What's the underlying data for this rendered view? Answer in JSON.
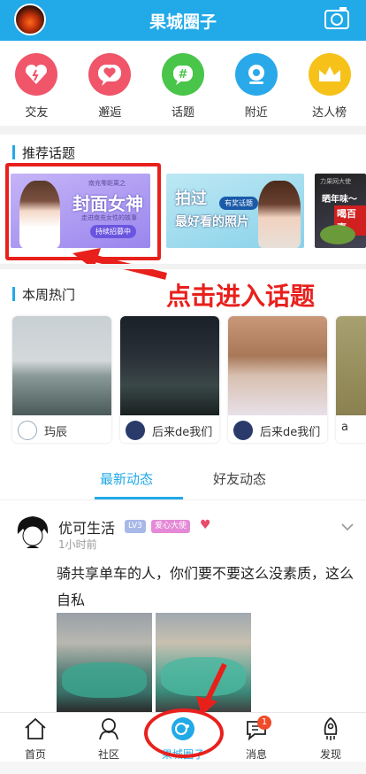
{
  "header": {
    "title": "果城圈子"
  },
  "nav_items": [
    {
      "label": "交友",
      "color": "#f0556a",
      "icon": "heart-friends-icon"
    },
    {
      "label": "邂逅",
      "color": "#f0556a",
      "icon": "heart-bubble-icon"
    },
    {
      "label": "话题",
      "color": "#49c54a",
      "icon": "hashtag-icon"
    },
    {
      "label": "附近",
      "color": "#2aa9ea",
      "icon": "location-icon"
    },
    {
      "label": "达人榜",
      "color": "#f6c21a",
      "icon": "crown-icon"
    }
  ],
  "sections": {
    "recommended": "推荐话题",
    "weekly_hot": "本周热门"
  },
  "topics": [
    {
      "small": "南充零距离之",
      "big": "封面女神",
      "sub": "走进南充女性的故事",
      "pill": "持续招募中"
    },
    {
      "big1": "拍过",
      "tag": "有奖话题",
      "big2": "最好看的照片"
    },
    {
      "brand": "力果网大使",
      "line1": "晒年味～",
      "line2": "喝百事"
    }
  ],
  "annotation": "点击进入话题",
  "hot_cards": [
    {
      "name": "玙辰"
    },
    {
      "name": "后来de我们"
    },
    {
      "name": "后来de我们"
    },
    {
      "name": "a"
    }
  ],
  "tabs": {
    "active": "最新动态",
    "inactive": "好友动态"
  },
  "post": {
    "author": "优可生活",
    "level": "LV3",
    "badge": "爱心大使",
    "time": "1小时前",
    "text": "骑共享单车的人，你们要不要这么没素质，这么自私"
  },
  "bottom_nav": {
    "home": "首页",
    "community": "社区",
    "circle": "果城圈子",
    "messages": "消息",
    "messages_badge": "1",
    "discover": "发现"
  },
  "colors": {
    "brand": "#21a9e8",
    "annotation_red": "#e8201c"
  }
}
